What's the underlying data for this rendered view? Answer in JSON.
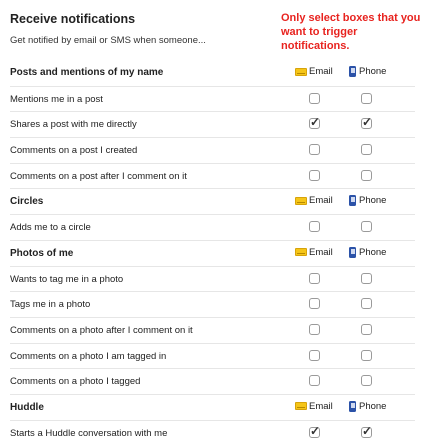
{
  "header": {
    "title": "Receive notifications",
    "subtitle": "Get notified by email or SMS when someone...",
    "warning": "Only select boxes that you want to trigger notifications."
  },
  "columns": {
    "email": "Email",
    "phone": "Phone"
  },
  "rows": [
    {
      "type": "section",
      "label": "Posts and mentions of my name"
    },
    {
      "type": "item",
      "label": "Mentions me in a post",
      "email": false,
      "phone": false
    },
    {
      "type": "item",
      "label": "Shares a post with me directly",
      "email": true,
      "phone": true
    },
    {
      "type": "item",
      "label": "Comments on a post I created",
      "email": false,
      "phone": false
    },
    {
      "type": "item",
      "label": "Comments on a post after I comment on it",
      "email": false,
      "phone": false
    },
    {
      "type": "section",
      "label": "Circles"
    },
    {
      "type": "item",
      "label": "Adds me to a circle",
      "email": false,
      "phone": false
    },
    {
      "type": "section",
      "label": "Photos of me"
    },
    {
      "type": "item",
      "label": "Wants to tag me in a photo",
      "email": false,
      "phone": false
    },
    {
      "type": "item",
      "label": "Tags me in a photo",
      "email": false,
      "phone": false
    },
    {
      "type": "item",
      "label": "Comments on a photo after I comment on it",
      "email": false,
      "phone": false
    },
    {
      "type": "item",
      "label": "Comments on a photo I am tagged in",
      "email": false,
      "phone": false
    },
    {
      "type": "item",
      "label": "Comments on a photo I tagged",
      "email": false,
      "phone": false
    },
    {
      "type": "section",
      "label": "Huddle"
    },
    {
      "type": "item",
      "label": "Starts a Huddle conversation with me",
      "email": true,
      "phone": true
    }
  ]
}
